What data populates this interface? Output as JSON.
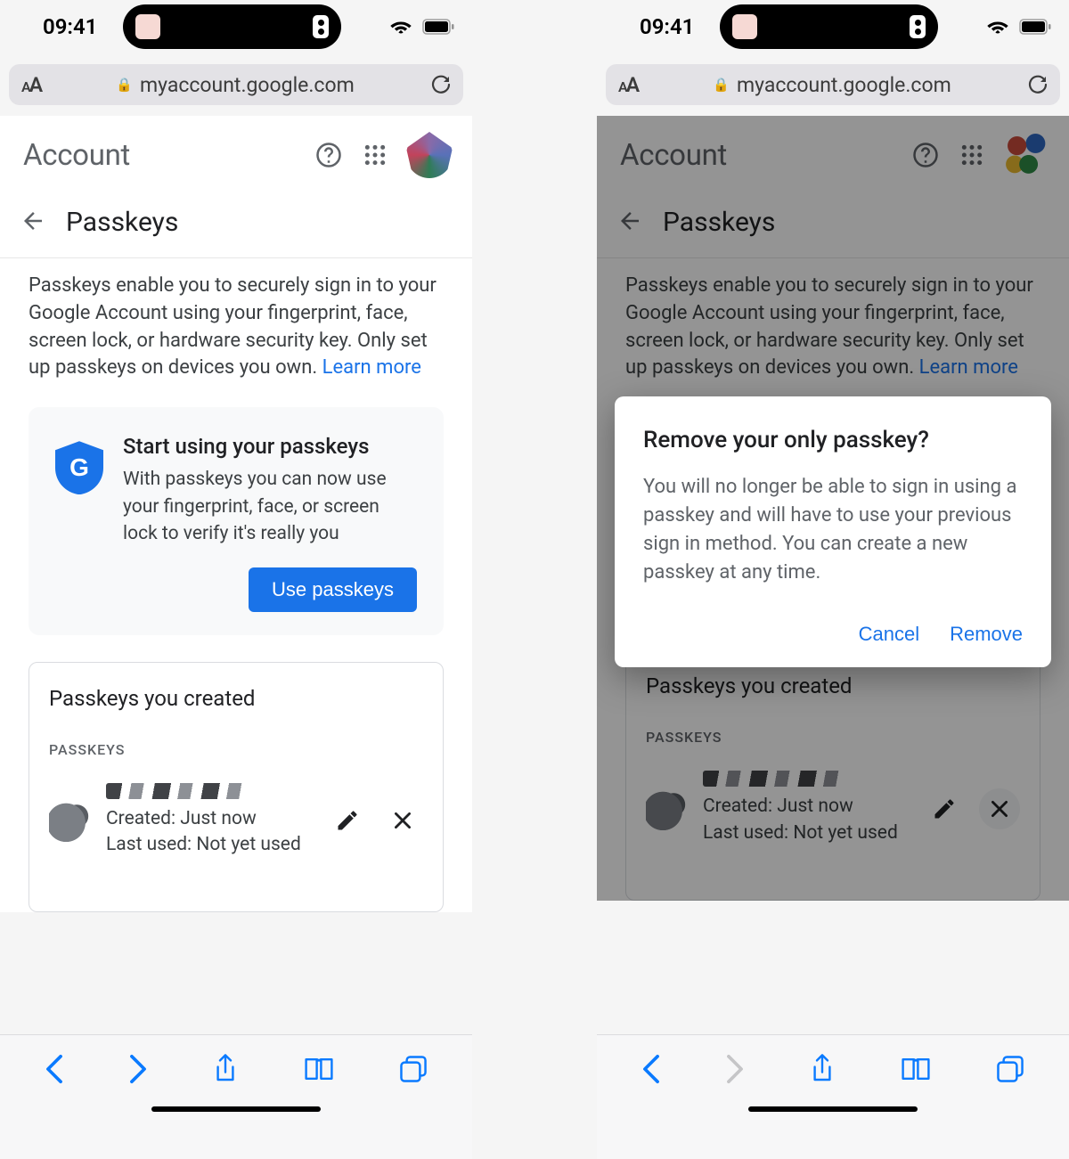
{
  "status": {
    "time": "09:41"
  },
  "url": "myaccount.google.com",
  "header": {
    "account_label": "Account"
  },
  "subheader": {
    "title": "Passkeys"
  },
  "intro": {
    "text": "Passkeys enable you to securely sign in to your Google Account using your fingerprint, face, screen lock, or hardware security key. Only set up passkeys on devices you own. ",
    "learn_more": "Learn more"
  },
  "promo": {
    "title": "Start using your passkeys",
    "body": "With passkeys you can now use your fingerprint, face, or screen lock to verify it's really you",
    "cta": "Use passkeys"
  },
  "list": {
    "title": "Passkeys you created",
    "section_label": "PASSKEYS",
    "item": {
      "created": "Created: Just now",
      "last_used": "Last used: Not yet used"
    }
  },
  "dialog": {
    "title": "Remove your only passkey?",
    "body": "You will no longer be able to sign in using a passkey and will have to use your previous sign in method. You can create a new passkey at any time.",
    "cancel": "Cancel",
    "remove": "Remove"
  }
}
